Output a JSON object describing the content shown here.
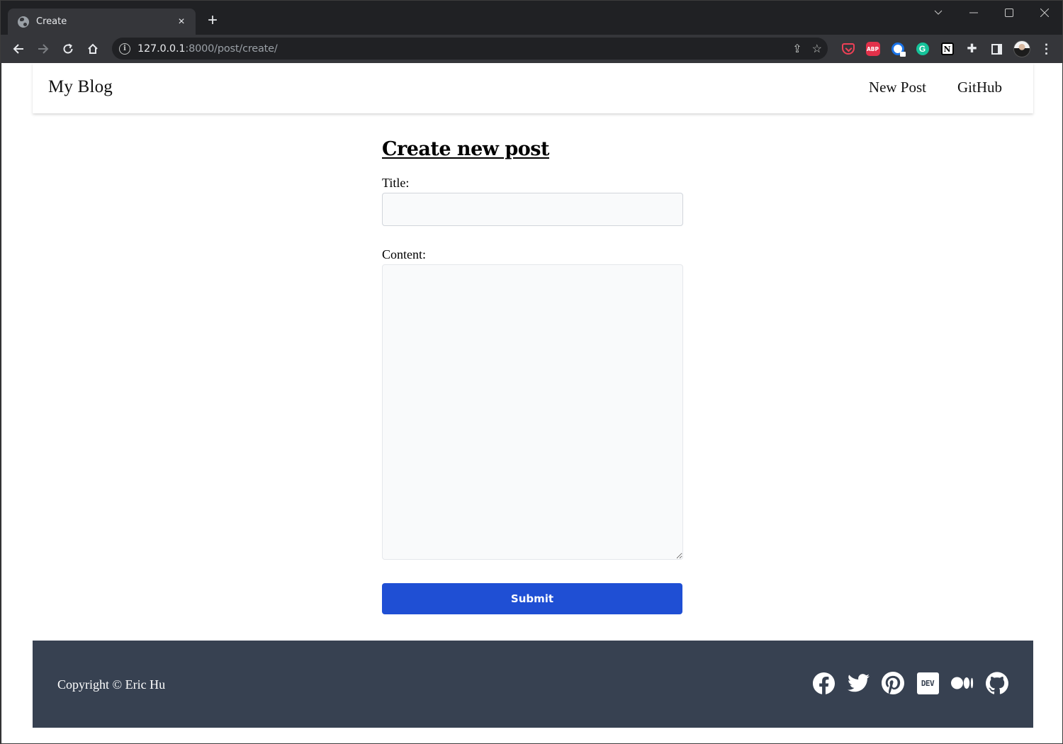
{
  "browser": {
    "tab": {
      "title": "Create",
      "close_label": "×"
    },
    "new_tab_label": "+",
    "window_controls": {
      "dropdown": "⌄",
      "minimize": "—",
      "maximize": "☐",
      "close": "✕"
    },
    "url_host": "127.0.0.1",
    "url_rest": ":8000/post/create/",
    "info_label": "i",
    "extensions": [
      {
        "name": "pocket",
        "label": ""
      },
      {
        "name": "adblock-plus",
        "label": "ABP"
      },
      {
        "name": "password-manager",
        "label": ""
      },
      {
        "name": "grammarly",
        "label": "G"
      },
      {
        "name": "notion",
        "label": "N"
      },
      {
        "name": "extensions-puzzle",
        "label": "✚"
      }
    ],
    "menu_label": "⋮"
  },
  "site": {
    "brand": "My Blog",
    "nav": [
      {
        "label": "New Post"
      },
      {
        "label": "GitHub"
      }
    ]
  },
  "form": {
    "heading": "Create new post",
    "title_label": "Title:",
    "title_value": "",
    "title_placeholder": "",
    "content_label": "Content:",
    "content_value": "",
    "content_placeholder": "",
    "submit_label": "Submit"
  },
  "footer": {
    "copyright": "Copyright © Eric Hu",
    "socials": [
      {
        "name": "facebook"
      },
      {
        "name": "twitter"
      },
      {
        "name": "pinterest"
      },
      {
        "name": "dev",
        "label": "DEV"
      },
      {
        "name": "medium"
      },
      {
        "name": "github"
      }
    ]
  },
  "colors": {
    "submit_bg": "#1f4fd4",
    "footer_bg": "#374151",
    "input_bg": "#f9fafb"
  }
}
